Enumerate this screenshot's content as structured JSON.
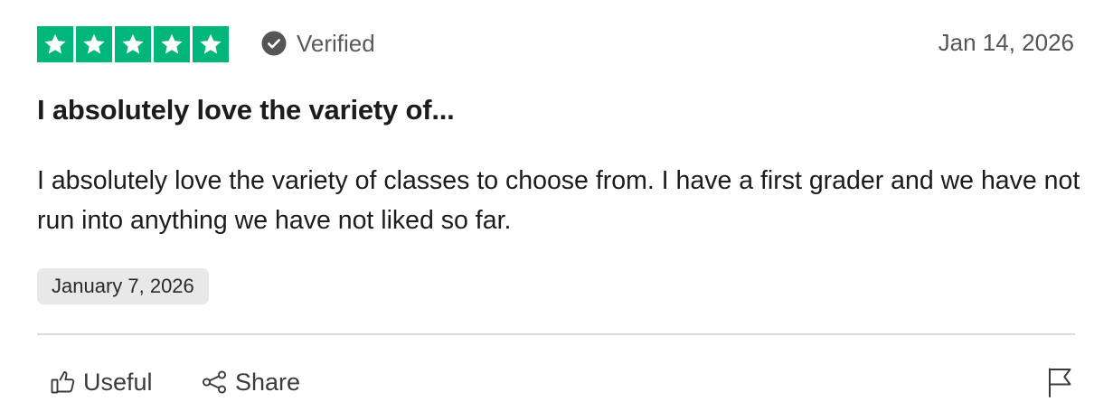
{
  "review": {
    "rating": 5,
    "rating_max": 5,
    "verified_label": "Verified",
    "published_date": "Jan 14, 2026",
    "title": "I absolutely love the variety of...",
    "body": "I absolutely love the variety of classes to choose from. I have a first grader and we have not run into anything we have not liked so far.",
    "experience_date": "January 7, 2026"
  },
  "actions": {
    "useful_label": "Useful",
    "share_label": "Share"
  },
  "icons": {
    "star": "star-icon",
    "verified": "check-circle-icon",
    "useful": "thumbs-up-icon",
    "share": "share-icon",
    "report": "flag-icon"
  },
  "colors": {
    "star_background": "#00b67a",
    "star_glyph": "#ffffff",
    "verified_icon": "#555555",
    "chip_background": "#e8e8e8"
  }
}
